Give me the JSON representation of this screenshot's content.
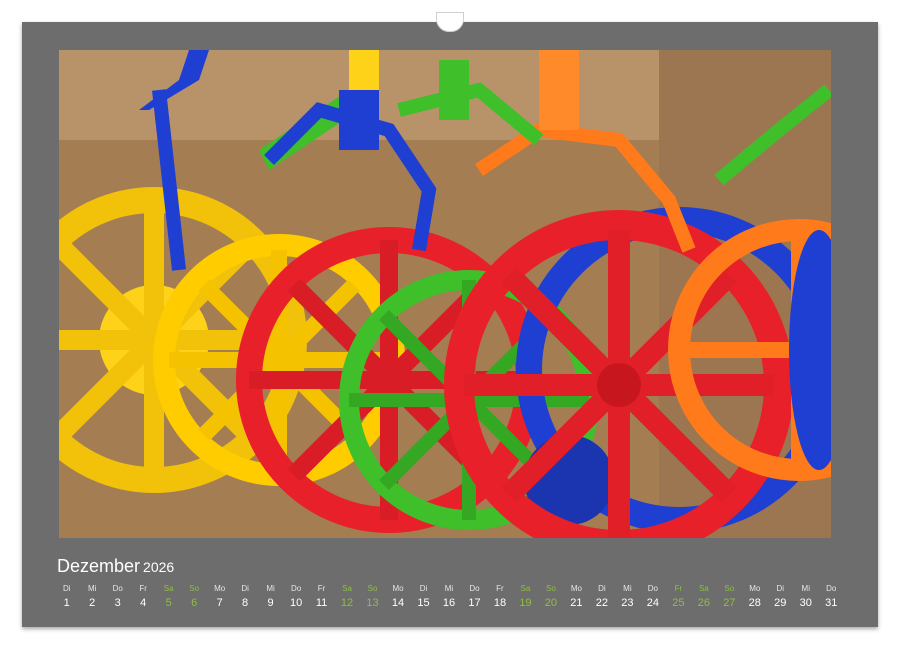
{
  "calendar": {
    "month": "Dezember",
    "year": "2026",
    "accent_color": "#8fbf3f",
    "days": [
      {
        "wd": "Di",
        "d": "1",
        "type": "normal"
      },
      {
        "wd": "Mi",
        "d": "2",
        "type": "normal"
      },
      {
        "wd": "Do",
        "d": "3",
        "type": "normal"
      },
      {
        "wd": "Fr",
        "d": "4",
        "type": "normal"
      },
      {
        "wd": "Sa",
        "d": "5",
        "type": "sat"
      },
      {
        "wd": "So",
        "d": "6",
        "type": "sun"
      },
      {
        "wd": "Mo",
        "d": "7",
        "type": "normal"
      },
      {
        "wd": "Di",
        "d": "8",
        "type": "normal"
      },
      {
        "wd": "Mi",
        "d": "9",
        "type": "normal"
      },
      {
        "wd": "Do",
        "d": "10",
        "type": "normal"
      },
      {
        "wd": "Fr",
        "d": "11",
        "type": "normal"
      },
      {
        "wd": "Sa",
        "d": "12",
        "type": "sat"
      },
      {
        "wd": "So",
        "d": "13",
        "type": "sun"
      },
      {
        "wd": "Mo",
        "d": "14",
        "type": "normal"
      },
      {
        "wd": "Di",
        "d": "15",
        "type": "normal"
      },
      {
        "wd": "Mi",
        "d": "16",
        "type": "normal"
      },
      {
        "wd": "Do",
        "d": "17",
        "type": "normal"
      },
      {
        "wd": "Fr",
        "d": "18",
        "type": "normal"
      },
      {
        "wd": "Sa",
        "d": "19",
        "type": "sat"
      },
      {
        "wd": "So",
        "d": "20",
        "type": "sun"
      },
      {
        "wd": "Mo",
        "d": "21",
        "type": "normal"
      },
      {
        "wd": "Di",
        "d": "22",
        "type": "normal"
      },
      {
        "wd": "Mi",
        "d": "23",
        "type": "normal"
      },
      {
        "wd": "Do",
        "d": "24",
        "type": "normal"
      },
      {
        "wd": "Fr",
        "d": "25",
        "type": "hol"
      },
      {
        "wd": "Sa",
        "d": "26",
        "type": "sat"
      },
      {
        "wd": "So",
        "d": "27",
        "type": "sun"
      },
      {
        "wd": "Mo",
        "d": "28",
        "type": "normal"
      },
      {
        "wd": "Di",
        "d": "29",
        "type": "normal"
      },
      {
        "wd": "Mi",
        "d": "30",
        "type": "normal"
      },
      {
        "wd": "Do",
        "d": "31",
        "type": "normal"
      }
    ]
  },
  "photo": {
    "colors": [
      "#e8202a",
      "#ffcc00",
      "#3fbf2a",
      "#1e3fd1",
      "#ff7a1a"
    ]
  }
}
